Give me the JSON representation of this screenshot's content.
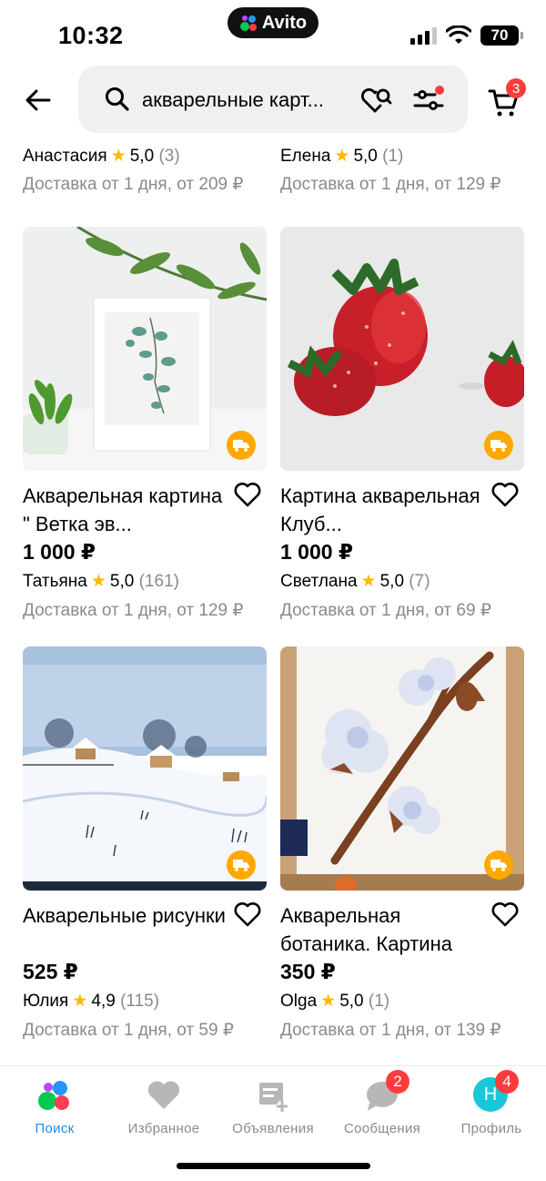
{
  "status_bar": {
    "time": "10:32",
    "app_pill": "Avito",
    "battery": "70"
  },
  "header": {
    "search_query": "акварельные карт...",
    "cart_count": "3"
  },
  "partial_row": [
    {
      "seller": "Анастасия",
      "rating": "5,0",
      "reviews": "(3)",
      "delivery": "Доставка от 1 дня, от 209 ₽"
    },
    {
      "seller": "Елена",
      "rating": "5,0",
      "reviews": "(1)",
      "delivery": "Доставка от 1 дня, от 129 ₽"
    }
  ],
  "products": [
    {
      "title": "Акварельная картина \" Ветка эв...",
      "price": "1 000 ₽",
      "seller": "Татьяна",
      "rating": "5,0",
      "reviews": "(161)",
      "delivery": "Доставка от 1 дня, от 129 ₽"
    },
    {
      "title": "Картина акварельная Клуб...",
      "price": "1 000 ₽",
      "seller": "Светлана",
      "rating": "5,0",
      "reviews": "(7)",
      "delivery": "Доставка от 1 дня, от 69 ₽"
    },
    {
      "title": "Акварельные рисунки",
      "price": "525 ₽",
      "seller": "Юлия",
      "rating": "4,9",
      "reviews": "(115)",
      "delivery": "Доставка от 1 дня, от 59 ₽"
    },
    {
      "title": "Акварельная ботаника. Картина",
      "price": "350 ₽",
      "seller": "Olga",
      "rating": "5,0",
      "reviews": "(1)",
      "delivery": "Доставка от 1 дня, от 139 ₽"
    }
  ],
  "rating_star": "★",
  "tabs": [
    {
      "label": "Поиск",
      "icon": "search-dots-icon",
      "active": true
    },
    {
      "label": "Избранное",
      "icon": "heart-icon"
    },
    {
      "label": "Объявления",
      "icon": "listing-add-icon"
    },
    {
      "label": "Сообщения",
      "icon": "chat-bubble-icon",
      "badge": "2"
    },
    {
      "label": "Профиль",
      "icon": "avatar-icon",
      "avatar_letter": "Н",
      "badge": "4"
    }
  ],
  "colors": {
    "accent_blue": "#1a8de8",
    "badge_red": "#ff3c3c",
    "star_yellow": "#ffb800",
    "delivery_orange": "#ffa800",
    "muted_text": "#8a8a8a",
    "search_bg": "#f0f0f0"
  }
}
